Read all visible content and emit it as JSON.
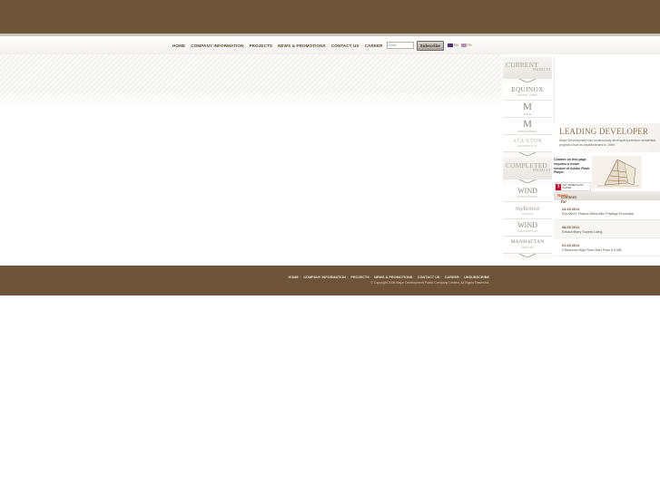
{
  "nav": {
    "items": [
      "HOME",
      "COMPANY INFORMATION",
      "PROJECTS",
      "NEWS & PROMOTIONS",
      "CONTACT US",
      "CAREER"
    ],
    "email_placeholder": "Email",
    "subscribe_label": "Subscribe",
    "languages": [
      "EN",
      "TH"
    ]
  },
  "sidebar": {
    "current_title": "CURRENT",
    "current_sub": "PROJECTS",
    "current_projects": [
      {
        "logo": "EQUINOX",
        "sub": "PHAHOL-VIBHA"
      },
      {
        "logo": "M",
        "sub": "MUSE"
      },
      {
        "logo": "M",
        "sub": "PHROMPHONG"
      },
      {
        "logo": "AGUSTON",
        "sub": "SUKHUMVIT 22"
      }
    ],
    "completed_title": "COMPLETED",
    "completed_sub": "PROJECTS",
    "completed_projects": [
      {
        "logo": "WIND",
        "sub": "RATCHAYOTHIN"
      },
      {
        "logo": "mykonos",
        "sub": "HUA HIN"
      },
      {
        "logo": "WIND",
        "sub": "SUKHUMVIT 23"
      },
      {
        "logo": "MANHATTAN",
        "sub": "CHIDLOM"
      }
    ]
  },
  "leader": {
    "title": "LEADING DEVELOPER",
    "text": "Major Development has continuously developed premium residential projects since its establishment in 1999."
  },
  "flash": {
    "note": "Content on this page requires a newer version of Adobe Flash Player.",
    "button_text": "GET ADOBE FLASH PLAYER"
  },
  "news": {
    "title_prefix": "Content for ",
    "title_highlight": "News",
    "items": [
      {
        "date": "24.06.2011",
        "text": "EQUINOX Phahol-Vibha offer Privilege Promotion"
      },
      {
        "date": "08.06.2011",
        "text": "Extraordinary Superb Living"
      },
      {
        "date": "01.06.2011",
        "text": "2 Bedroom High Floor Start From 6.9 MB"
      }
    ]
  },
  "footer": {
    "links": [
      "HOME",
      "COMPANY INFORMATION",
      "PROJECTS",
      "NEWS & PROMOTIONS",
      "CONTACT US",
      "CAREER",
      "UNSUBSCRIBE"
    ],
    "copyright": "© Copyright 2006  Major Development Public Company Limited. All Rights Reserved."
  }
}
